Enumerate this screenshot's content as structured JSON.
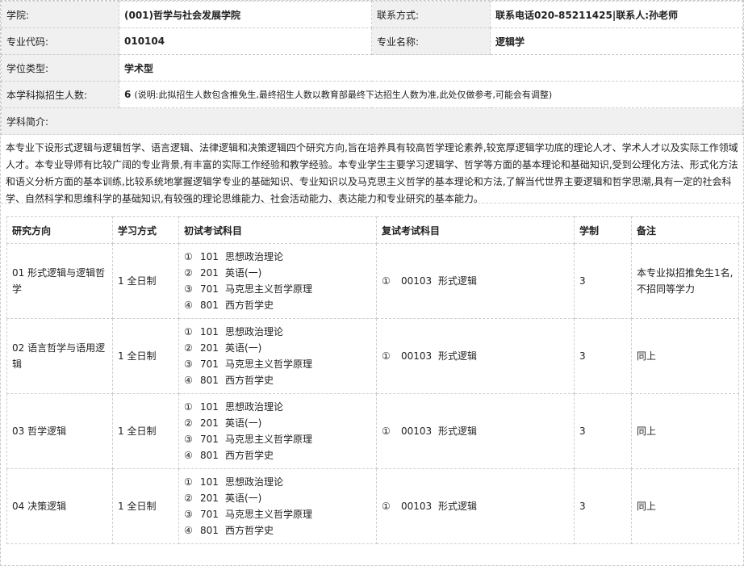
{
  "info": {
    "college_label": "学院:",
    "college_value": "(001)哲学与社会发展学院",
    "contact_label": "联系方式:",
    "contact_value": "联系电话020-85211425|联系人:孙老师",
    "major_code_label": "专业代码:",
    "major_code_value": "010104",
    "major_name_label": "专业名称:",
    "major_name_value": "逻辑学",
    "degree_type_label": "学位类型:",
    "degree_type_value": "学术型",
    "enroll_label": "本学科拟招生人数:",
    "enroll_value": "6",
    "enroll_note": "(说明:此拟招生人数包含推免生,最终招生人数以教育部最终下达招生人数为准,此处仅做参考,可能会有调整)",
    "intro_label": "学科简介:",
    "intro_text": "本专业下设形式逻辑与逻辑哲学、语言逻辑、法律逻辑和决策逻辑四个研究方向,旨在培养具有较高哲学理论素养,较宽厚逻辑学功底的理论人才、学术人才以及实际工作领域人才。本专业导师有比较广阔的专业背景,有丰富的实际工作经验和教学经验。本专业学生主要学习逻辑学、哲学等方面的基本理论和基础知识,受到公理化方法、形式化方法和语义分析方面的基本训练,比较系统地掌握逻辑学专业的基础知识、专业知识以及马克思主义哲学的基本理论和方法,了解当代世界主要逻辑和哲学思潮,具有一定的社会科学、自然科学和思维科学的基础知识,有较强的理论思维能力、社会活动能力、表达能力和专业研究的基本能力。"
  },
  "table": {
    "headers": [
      "研究方向",
      "学习方式",
      "初试考试科目",
      "复试考试科目",
      "学制",
      "备注"
    ],
    "rows": [
      {
        "direction": "01 形式逻辑与逻辑哲学",
        "mode": "1 全日制",
        "subjects": [
          {
            "num": "①",
            "code": "101",
            "name": "思想政治理论"
          },
          {
            "num": "②",
            "code": "201",
            "name": "英语(一)"
          },
          {
            "num": "③",
            "code": "701",
            "name": "马克思主义哲学原理"
          },
          {
            "num": "④",
            "code": "801",
            "name": "西方哲学史"
          }
        ],
        "retest": {
          "num": "①",
          "code": "00103",
          "name": "形式逻辑"
        },
        "years": "3",
        "remark": "本专业拟招推免生1名,不招同等学力"
      },
      {
        "direction": "02 语言哲学与语用逻辑",
        "mode": "1 全日制",
        "subjects": [
          {
            "num": "①",
            "code": "101",
            "name": "思想政治理论"
          },
          {
            "num": "②",
            "code": "201",
            "name": "英语(一)"
          },
          {
            "num": "③",
            "code": "701",
            "name": "马克思主义哲学原理"
          },
          {
            "num": "④",
            "code": "801",
            "name": "西方哲学史"
          }
        ],
        "retest": {
          "num": "①",
          "code": "00103",
          "name": "形式逻辑"
        },
        "years": "3",
        "remark": "同上"
      },
      {
        "direction": "03 哲学逻辑",
        "mode": "1 全日制",
        "subjects": [
          {
            "num": "①",
            "code": "101",
            "name": "思想政治理论"
          },
          {
            "num": "②",
            "code": "201",
            "name": "英语(一)"
          },
          {
            "num": "③",
            "code": "701",
            "name": "马克思主义哲学原理"
          },
          {
            "num": "④",
            "code": "801",
            "name": "西方哲学史"
          }
        ],
        "retest": {
          "num": "①",
          "code": "00103",
          "name": "形式逻辑"
        },
        "years": "3",
        "remark": "同上"
      },
      {
        "direction": "04 决策逻辑",
        "mode": "1 全日制",
        "subjects": [
          {
            "num": "①",
            "code": "101",
            "name": "思想政治理论"
          },
          {
            "num": "②",
            "code": "201",
            "name": "英语(一)"
          },
          {
            "num": "③",
            "code": "701",
            "name": "马克思主义哲学原理"
          },
          {
            "num": "④",
            "code": "801",
            "name": "西方哲学史"
          }
        ],
        "retest": {
          "num": "①",
          "code": "00103",
          "name": "形式逻辑"
        },
        "years": "3",
        "remark": "同上"
      }
    ]
  }
}
